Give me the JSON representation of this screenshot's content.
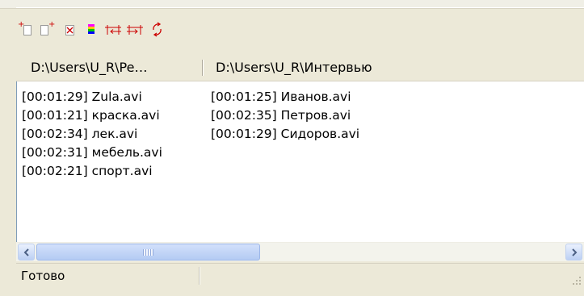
{
  "toolbar": {
    "buttons": [
      {
        "name": "add-before-icon"
      },
      {
        "name": "add-after-icon"
      },
      {
        "name": "delete-icon"
      },
      {
        "name": "color-icon"
      },
      {
        "name": "merge-left-icon"
      },
      {
        "name": "merge-right-icon"
      },
      {
        "name": "refresh-icon"
      }
    ]
  },
  "columns": {
    "left_header": "D:\\Users\\U_R\\Pe…",
    "right_header": "D:\\Users\\U_R\\Интервью",
    "left_items": [
      "[00:01:29] Zula.avi",
      "[00:01:21] краска.avi",
      "[00:02:34] лек.avi",
      "[00:02:31] мебель.avi",
      "[00:02:21] спорт.avi"
    ],
    "right_items": [
      "[00:01:25] Иванов.avi",
      "[00:02:35] Петров.avi",
      "[00:01:29] Сидоров.avi"
    ]
  },
  "status": {
    "text": "Готово"
  },
  "colors": {
    "accent": "#cc0000",
    "scrollbar": "#b4cbf3"
  }
}
